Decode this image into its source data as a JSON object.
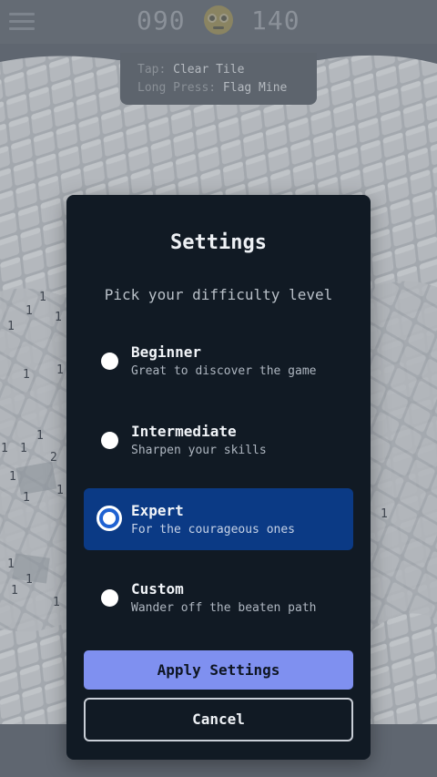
{
  "header": {
    "menu_icon": "hamburger-icon",
    "mines_remaining": "090",
    "face_icon": "nerd-face-icon",
    "timer": "140"
  },
  "hint": {
    "tap_key": "Tap:",
    "tap_value": "Clear Tile",
    "long_press_key": "Long Press:",
    "long_press_value": "Flag Mine"
  },
  "board": {
    "visible_numbers": [
      "1",
      "1",
      "1",
      "1",
      "1",
      "1",
      "1",
      "1",
      "1",
      "2",
      "1",
      "1",
      "1",
      "1",
      "1",
      "1",
      "1",
      "1",
      "1"
    ]
  },
  "settings": {
    "title": "Settings",
    "subtitle": "Pick your difficulty level",
    "options": [
      {
        "label": "Beginner",
        "description": "Great to discover the game",
        "selected": false
      },
      {
        "label": "Intermediate",
        "description": "Sharpen your skills",
        "selected": false
      },
      {
        "label": "Expert",
        "description": "For the courageous ones",
        "selected": true
      },
      {
        "label": "Custom",
        "description": "Wander off the beaten path",
        "selected": false
      }
    ],
    "apply_label": "Apply Settings",
    "cancel_label": "Cancel"
  },
  "colors": {
    "background": "#5f6670",
    "modal": "#111a24",
    "selected": "#0b3a85",
    "apply_button": "#7f90f0"
  }
}
